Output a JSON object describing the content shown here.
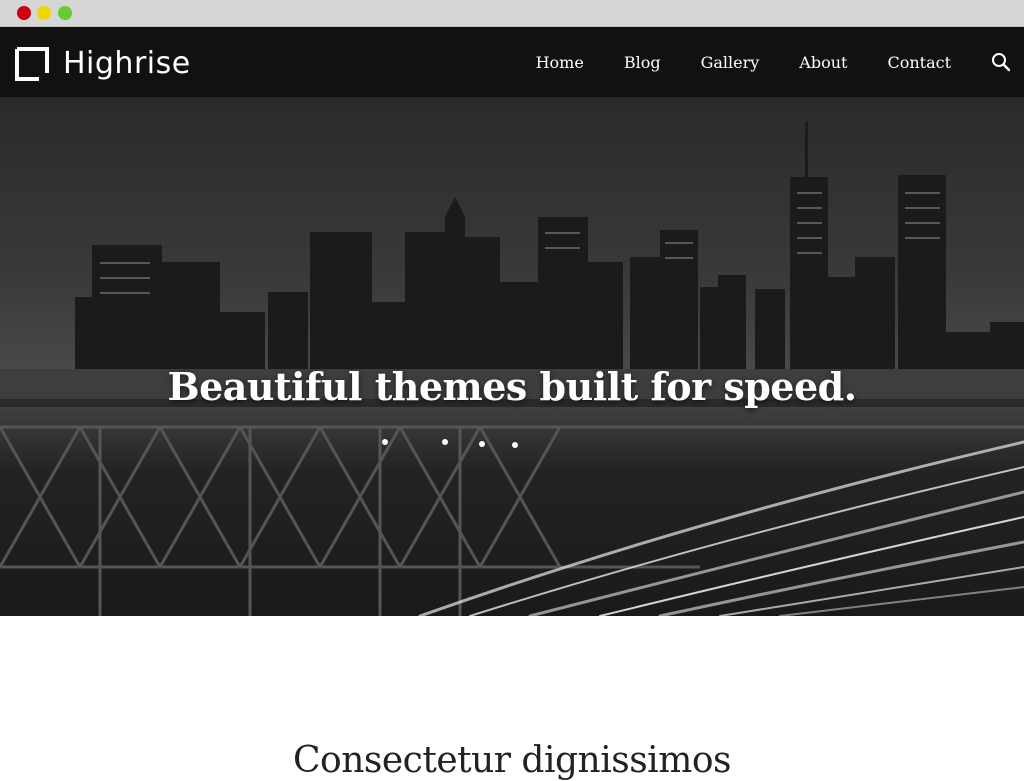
{
  "browser": {
    "controls": [
      "close",
      "minimize",
      "zoom"
    ]
  },
  "header": {
    "logo_text": "Highrise",
    "logo_icon": "square-bracket-logo-icon",
    "nav": [
      {
        "label": "Home"
      },
      {
        "label": "Blog"
      },
      {
        "label": "Gallery"
      },
      {
        "label": "About"
      },
      {
        "label": "Contact"
      }
    ],
    "search_icon": "search-icon"
  },
  "hero": {
    "title": "Beautiful themes built for speed.",
    "image": "black-and-white city skyline at night with bridge and light trails"
  },
  "main": {
    "section_heading": "Consectetur dignissimos"
  },
  "colors": {
    "header_bg": "#111111",
    "chrome_bg": "#d6d6d6",
    "text_dark": "#222222",
    "dot_red": "#cc0012",
    "dot_yellow": "#f0d500",
    "dot_green": "#66cc33"
  }
}
